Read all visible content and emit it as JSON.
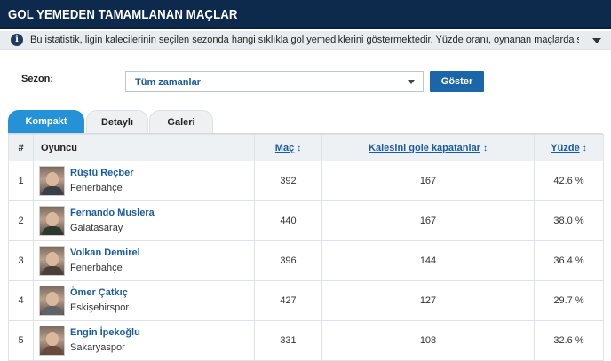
{
  "header": {
    "title": "GOL YEMEDEN TAMAMLANAN MAÇLAR"
  },
  "info": {
    "icon": "info-icon",
    "text": "Bu istatistik, ligin kalecilerinin seçilen sezonda hangi sıklıkla gol yemediklerini göstermektedir. Yüzde oranı, oynanan maçlarda sıfır gol maçlar"
  },
  "filter": {
    "season_label": "Sezon:",
    "season_value": "Tüm zamanlar",
    "show_button": "Göster"
  },
  "tabs": [
    {
      "label": "Kompakt",
      "active": true
    },
    {
      "label": "Detaylı",
      "active": false
    },
    {
      "label": "Galeri",
      "active": false
    }
  ],
  "table": {
    "headers": {
      "idx": "#",
      "player": "Oyuncu",
      "matches": "Maç",
      "conceded": "Kalesini gole kapatanlar",
      "pct": "Yüzde"
    },
    "rows": [
      {
        "idx": "1",
        "name": "Rüştü Reçber",
        "team": "Fenerbahçe",
        "matches": "392",
        "conceded": "167",
        "pct": "42.6 %"
      },
      {
        "idx": "2",
        "name": "Fernando Muslera",
        "team": "Galatasaray",
        "matches": "440",
        "conceded": "167",
        "pct": "38.0 %"
      },
      {
        "idx": "3",
        "name": "Volkan Demirel",
        "team": "Fenerbahçe",
        "matches": "396",
        "conceded": "144",
        "pct": "36.4 %"
      },
      {
        "idx": "4",
        "name": "Ömer Çatkıç",
        "team": "Eskişehirspor",
        "matches": "427",
        "conceded": "127",
        "pct": "29.7 %"
      },
      {
        "idx": "5",
        "name": "Engin İpekoğlu",
        "team": "Sakaryaspor",
        "matches": "331",
        "conceded": "108",
        "pct": "32.6 %"
      }
    ]
  },
  "colors": {
    "header_bg": "#0d2a4d",
    "accent_blue": "#2591d7",
    "link_blue": "#1a5aa0",
    "button_blue": "#1a66a8"
  }
}
